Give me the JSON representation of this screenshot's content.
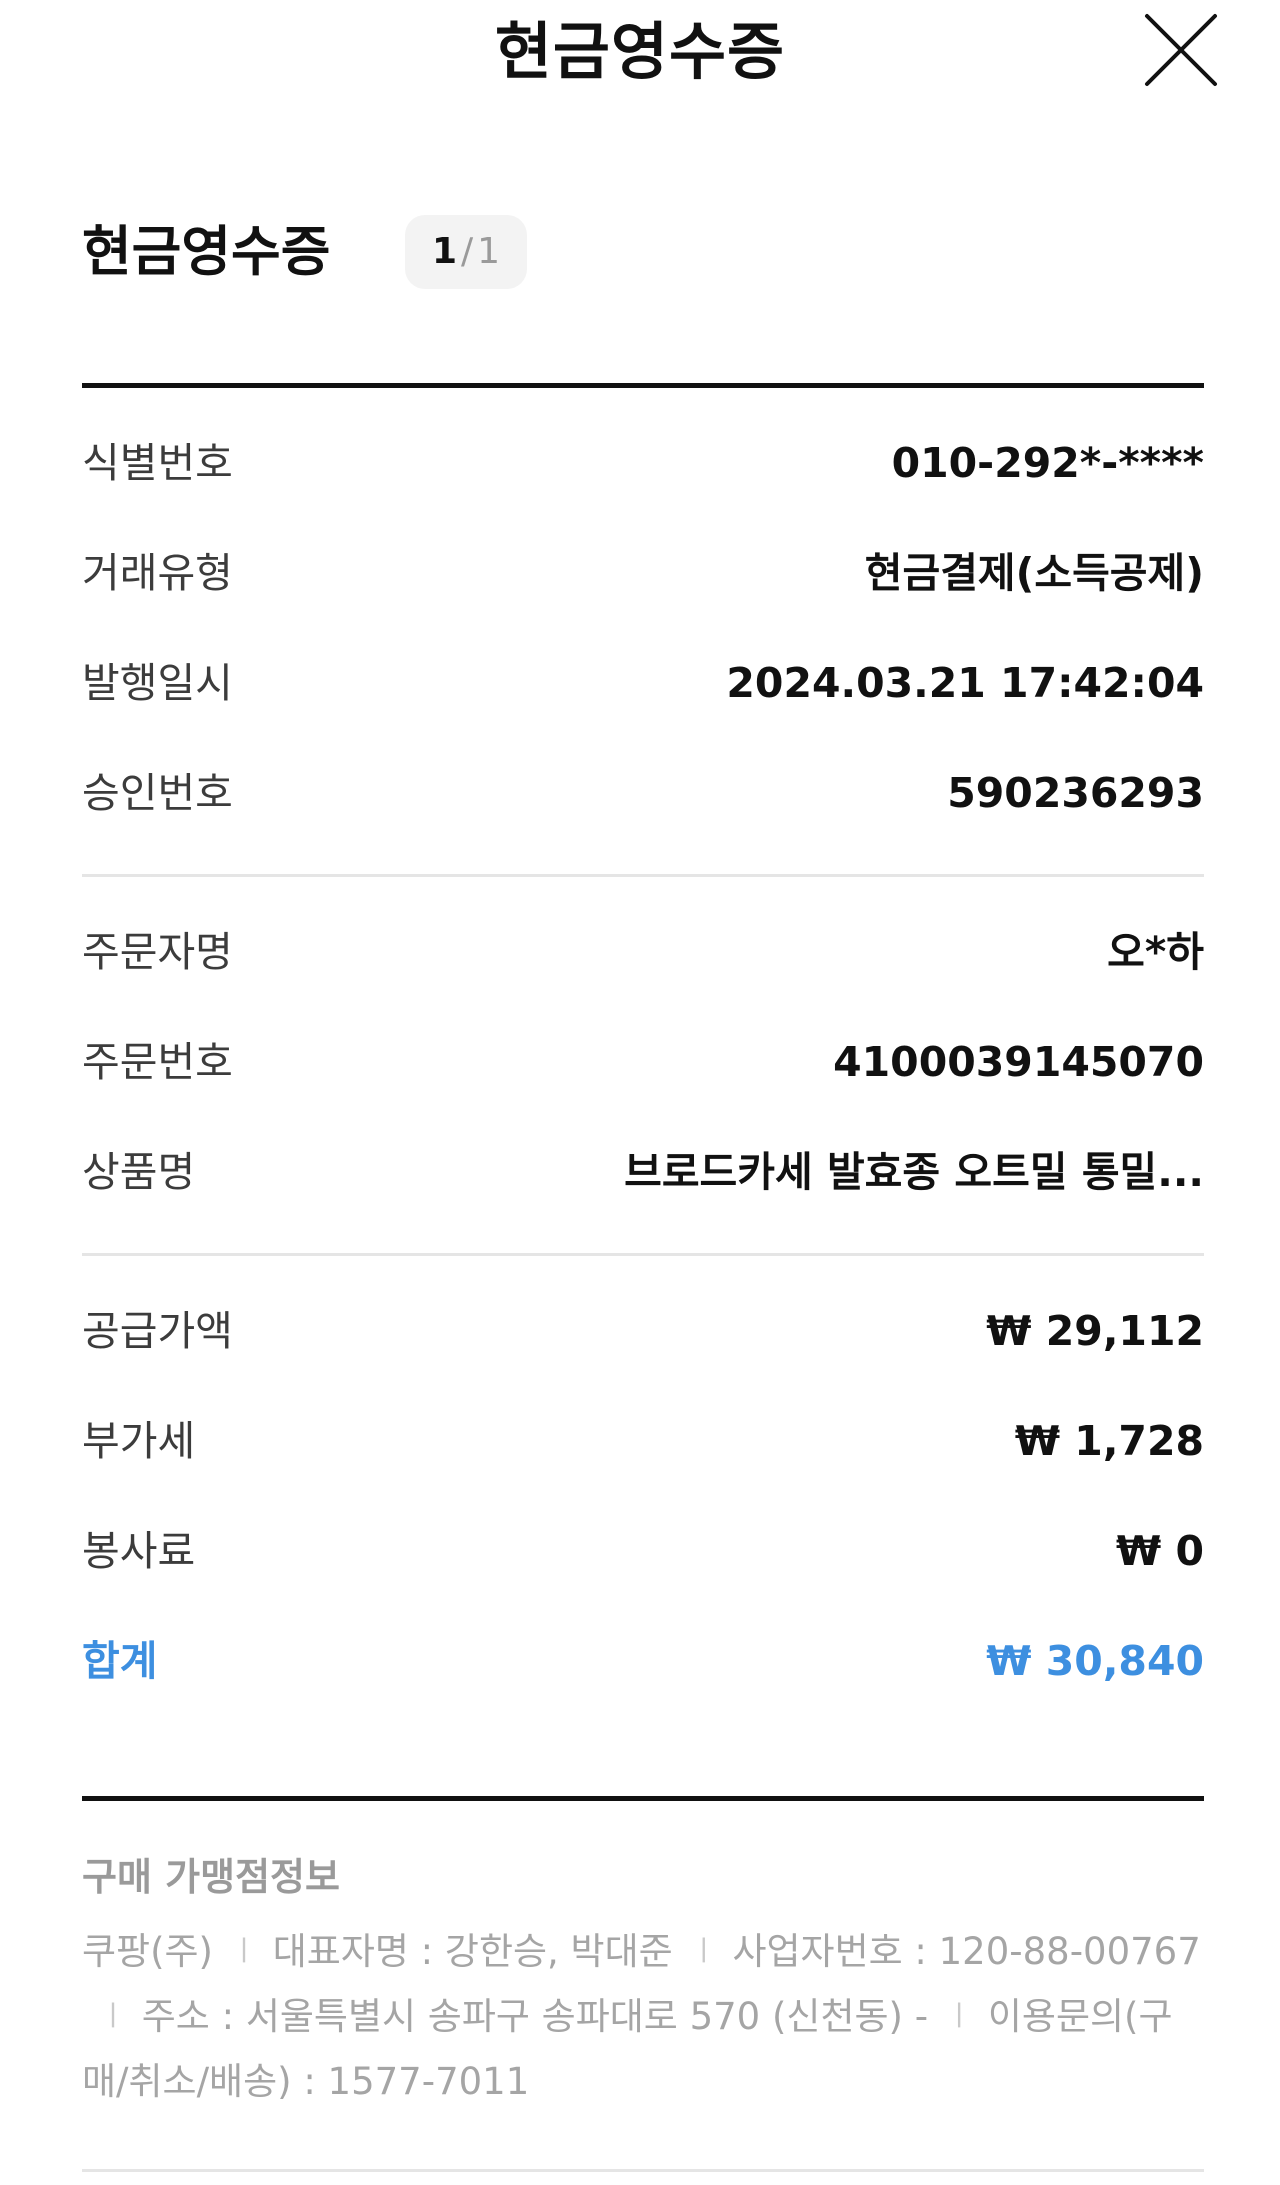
{
  "header": {
    "title": "현금영수증",
    "close_icon": "close-icon"
  },
  "receipt": {
    "title": "현금영수증",
    "page_current": "1",
    "page_separator": "/",
    "page_total": "1",
    "group1": [
      {
        "label": "식별번호",
        "value": "010-292*-****"
      },
      {
        "label": "거래유형",
        "value": "현금결제(소득공제)"
      },
      {
        "label": "발행일시",
        "value": "2024.03.21 17:42:04"
      },
      {
        "label": "승인번호",
        "value": "590236293"
      }
    ],
    "group2": [
      {
        "label": "주문자명",
        "value": "오*하"
      },
      {
        "label": "주문번호",
        "value": "4100039145070"
      },
      {
        "label": "상품명",
        "value": "브로드카세 발효종 오트밀 통밀..."
      }
    ],
    "group3": [
      {
        "label": "공급가액",
        "value": "₩ 29,112"
      },
      {
        "label": "부가세",
        "value": "₩ 1,728"
      },
      {
        "label": "봉사료",
        "value": "₩ 0"
      }
    ],
    "total": {
      "label": "합계",
      "value": "₩ 30,840"
    },
    "total_color": "#3d8fe0"
  },
  "store": {
    "title": "구매 가맹점정보",
    "company": "쿠팡(주)",
    "representative": "대표자명 : 강한승, 박대준",
    "business_number": "사업자번호 : 120-88-00767",
    "address": "주소 : 서울특별시 송파구 송파대로 570 (신천동) -",
    "inquiry": "이용문의(구매/취소/배송) : 1577-7011",
    "separator": "ㅣ"
  }
}
